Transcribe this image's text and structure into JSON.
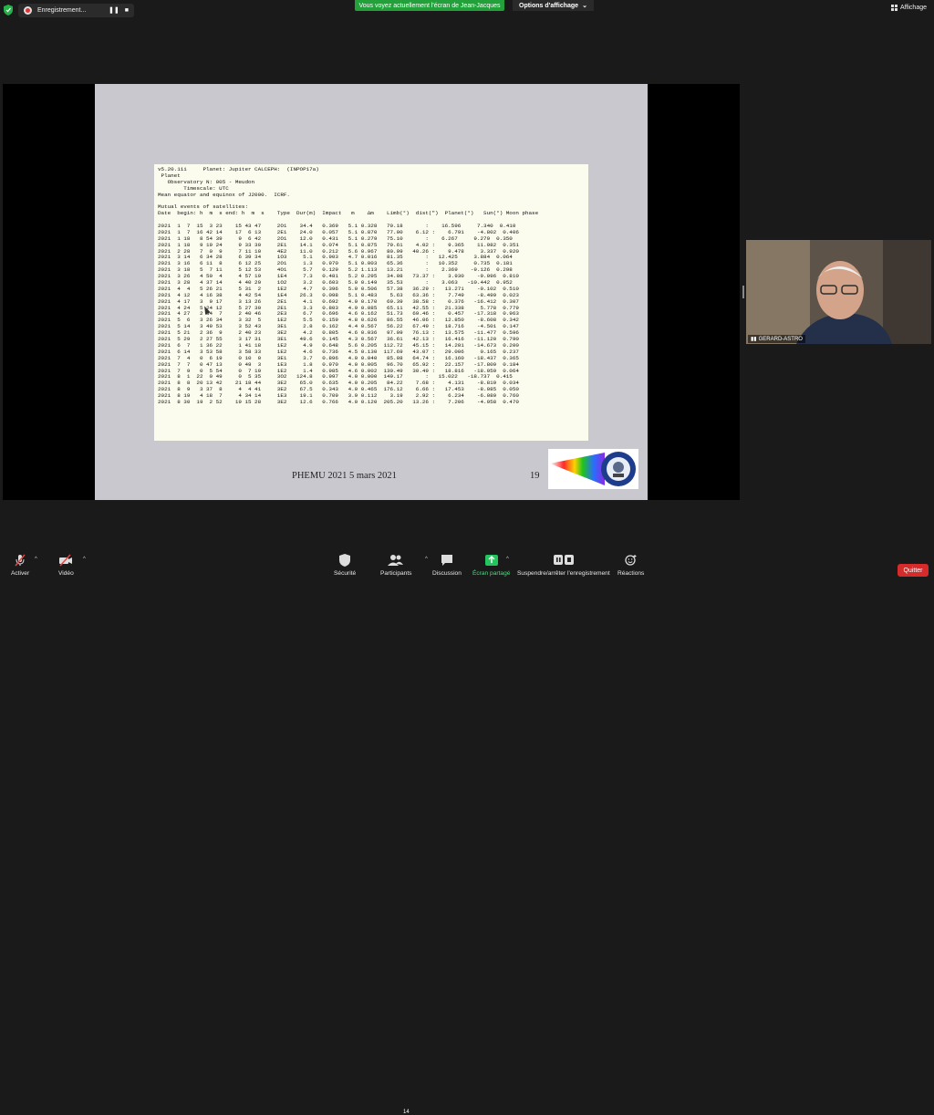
{
  "top": {
    "recording_label": "Enregistrement...",
    "pause_glyph": "❚❚",
    "stop_glyph": "■",
    "share_banner": "Vous voyez actuellement l'écran de Jean-Jacques",
    "view_options": "Options d'affichage",
    "affichage": "Affichage"
  },
  "slide": {
    "lines": [
      "v5.20.11i     Planet: Jupiter CALCEPH:  (INPOP17a)",
      " Planet",
      "   Observatory N: 005 - Meudon",
      "        Timescale: UTC",
      "Mean equator and equinox of J2000.  ICRF.",
      "",
      "Mutual events of satellites:",
      "Date  begin: h  m  s end: h  m  s    Type  Dur(m)  Impact   m    Δm    Limb(°)  dist(\")  Planet(°)   Sun(°) Moon phase",
      "",
      "2021  1  7  15  3 23    15 43 47     2O1    34.4   0.369   5.1 0.328   70.18       :    16.596     7.340  0.410",
      "2021  1  7  16 42 14    17  6 13     2E1    24.0   0.057   5.1 0.870   77.00    6.12 :    6.791    -4.802  0.406",
      "2021  1 18   8 54 39     9  6 42     2O1    12.0   0.431   5.1 0.279   75.10       :    6.267     9.279  0.350",
      "2021  1 18   9 19 24     9 33 30     2E1    14.1   0.074   5.1 0.875   79.61    4.02 :    9.365    11.982  0.351",
      "2021  2 28   7  0  9     7 11 10     4E2    11.0   0.212   5.6 0.967   80.99   40.26 :    9.478     3.337  0.920",
      "2021  3 14   6 34 28     6 39 34     1O3     5.1   0.903   4.7 0.016   81.35       :   12.425     3.884  0.064",
      "2021  3 16   6 11  8     6 12 25     2O1     1.3   0.970   5.1 0.003   65.36       :   10.352     0.735  0.181",
      "2021  3 18   5  7 11     5 12 53     4O1     5.7   0.129   5.2 1.113   13.21       :    2.369    -9.126  0.298",
      "2021  3 26   4 50  4     4 57 19     1E4     7.3   0.481   5.2 0.295   34.08   73.37 :    3.930    -9.096  0.810",
      "2021  3 28   4 37 14     4 40 29     1O2     3.2   0.603   5.0 0.149   35.53       :    3.063   -10.442  0.952",
      "2021  4  4   5 26 21     5 31  2     1E2     4.7   0.396   5.0 0.506   57.38   36.29 :   13.271    -0.102  0.510",
      "2021  4 12   4 16 38     4 42 54     1E4    26.3   0.098   5.1 0.483    5.63   63.36 :    7.749    -8.499  0.023",
      "2021  4 17   3  9 17     3 13 26     2E1     4.1   0.692   4.9 0.170   69.39   38.58 :    0.376   -16.412  0.307",
      "2021  4 24   5 24 12     5 27 30     2E1     3.3   0.803   4.9 0.085   65.11   42.55 :   21.338     5.778  0.779",
      "2021  4 27   2 34  7     2 40 46     2E3     6.7   0.696   4.6 0.162   51.73   69.46 :    0.457   -17.318  0.963",
      "2021  5  6   3 26 34     3 32  5     1E2     5.5   0.159   4.8 0.626   86.55   46.06 :   12.850    -8.608  0.342",
      "2021  5 14   3 49 53     3 52 43     3E1     2.8   0.162   4.4 0.567   56.22   67.49 :   18.716    -4.501  0.147",
      "2021  5 21   2 36  9     2 40 23     3E2     4.2   0.805   4.6 0.036   97.09   76.13 :   13.575   -11.477  0.596",
      "2021  5 29   2 27 55     3 17 31     3E1    49.6   0.145   4.3 0.567   36.61   42.13 :   16.416   -11.120  0.790",
      "2021  6  7   1 36 22     1 41 18     1E2     4.9   0.648   5.6 0.205  112.72   45.15 :   14.201   -14.673  0.200",
      "2021  6 14   3 53 58     3 58 33     1E2     4.6   0.736   4.5 0.130  117.69   43.07 :   29.006     0.165  0.237",
      "2021  7  4   0  6 19     0 10  0     3E1     3.7   0.896   4.0 0.040   85.08   64.74 :   16.160   -18.437  0.365",
      "2021  7  7   0 47 13     0 49  3     1E3     1.8   0.970   4.0 0.005   96.70   65.92 :   22.157   -17.809  0.184",
      "2021  7  9   0  5 54     0  7 19     1E2     1.4   0.985   4.6 0.002  130.49   30.49 :   18.816   -18.959  0.064",
      "2021  8  1  22  0 49     0  5 35     3O2   124.8   0.997   4.0 0.000  149.17       :   15.022   -18.737  0.415",
      "2021  8  8  20 13 42    21 18 44     3E2    65.0   0.635   4.0 0.205   84.22    7.68 :    4.131    -8.819  0.034",
      "2021  8  9   3 37  8     4  4 41     3E2    67.5   0.343   4.0 0.465  176.12    6.66 :   17.453    -8.085  0.050",
      "2021  8 19   4 18  7     4 34 14     1E3    19.1   0.709   3.9 0.112    3.19    2.92 :    6.234    -6.089  0.760",
      "2021  8 30  19  2 52    19 15 28     3E2    12.6   0.766   4.0 0.120  205.20   13.26 :    7.206    -4.958  0.470"
    ],
    "footer_left": "PHEMU 2021    5 mars 2021",
    "page_number": "19",
    "logo_ring_text": "CLUB D'ASTRONOMIE · GASTON"
  },
  "video": {
    "participant_name": "GERARD-ASTRO"
  },
  "toolbar": {
    "audio": "Activer",
    "video": "Vidéo",
    "security": "Sécurité",
    "participants": "Participants",
    "participants_count": "14",
    "discussion": "Discussion",
    "share_screen": "Écran partagé",
    "recording": "Suspendre/arrêter l'enregistrement",
    "reactions": "Réactions",
    "quit": "Quitter"
  },
  "colors": {
    "banner_green": "#22a03a",
    "share_green": "#22c55e",
    "quit_red": "#d52b2b",
    "mute_red": "#e04848"
  }
}
